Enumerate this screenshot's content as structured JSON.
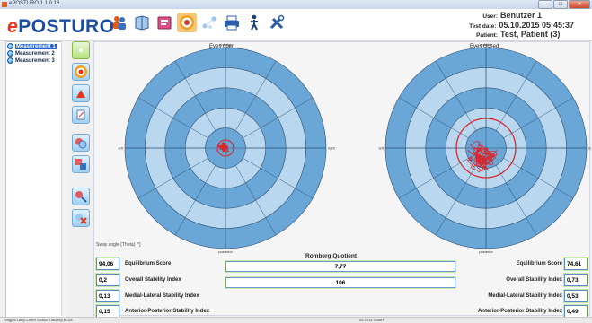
{
  "window": {
    "title": "ePOSTURO 1.1.0.18"
  },
  "logo": {
    "prefix": "e",
    "main": "POSTURO"
  },
  "toolbar": {
    "items": [
      {
        "name": "people-icon",
        "color": "#3a6fbf"
      },
      {
        "name": "book-icon",
        "color": "#7aa7d8"
      },
      {
        "name": "report-icon",
        "color": "#e04f86"
      },
      {
        "name": "target-icon",
        "color": "#f0a020"
      },
      {
        "name": "network-icon",
        "color": "#9cc3e8"
      },
      {
        "name": "print-icon",
        "color": "#2b5fae"
      },
      {
        "name": "person-icon",
        "color": "#1e3f7a"
      },
      {
        "name": "tools-icon",
        "color": "#2c5aa0"
      }
    ]
  },
  "user_info": {
    "user_label": "User:",
    "user_value": "Benutzer 1",
    "date_label": "Test date:",
    "date_value": "05.10.2015 05:45:37",
    "patient_label": "Patient:",
    "patient_value": "Test, Patient (3)"
  },
  "measurements": [
    {
      "label": "Measurement 1",
      "selected": true
    },
    {
      "label": "Measurement 2",
      "selected": false
    },
    {
      "label": "Measurement 3",
      "selected": false
    }
  ],
  "tool_column": {
    "items": [
      "home-icon",
      "target-icon",
      "chart-icon",
      "document-icon",
      "compare-icon",
      "layout-icon",
      "search-icon",
      "delete-icon"
    ]
  },
  "plots": {
    "left_title": "Eyes open",
    "right_title": "Eyes closed",
    "dir_top": "anterior",
    "dir_bottom": "posterior",
    "dir_left": "left",
    "dir_right": "right",
    "sway_label": "Sway angle (Theta) [°]"
  },
  "romberg": {
    "title": "Romberg Quotient",
    "value1": "7,77",
    "value2": "106"
  },
  "left_stats": [
    {
      "value": "94,06",
      "label": "Equilibrium Score"
    },
    {
      "value": "0,2",
      "label": "Overall Stability Index"
    },
    {
      "value": "0,13",
      "label": "Medial-Lateral Stability Index"
    },
    {
      "value": "0,15",
      "label": "Anterior-Posterior Stability Index"
    }
  ],
  "right_stats": [
    {
      "value": "74,61",
      "label": "Equilibrium Score"
    },
    {
      "value": "0,73",
      "label": "Overall Stability Index"
    },
    {
      "value": "0,53",
      "label": "Medial-Lateral Stability Index"
    },
    {
      "value": "0,49",
      "label": "Anterior-Posterior Stability Index"
    }
  ],
  "status_bar": {
    "left": "Ringpol Lang GmbH    Motion Tracking BLUE",
    "center": "05.2015 GmbH"
  },
  "colors": {
    "accent": "#1c4da1",
    "trace": "#d8262a",
    "ring_dark": "#6aa6d6",
    "ring_light": "#b9d8f0"
  }
}
